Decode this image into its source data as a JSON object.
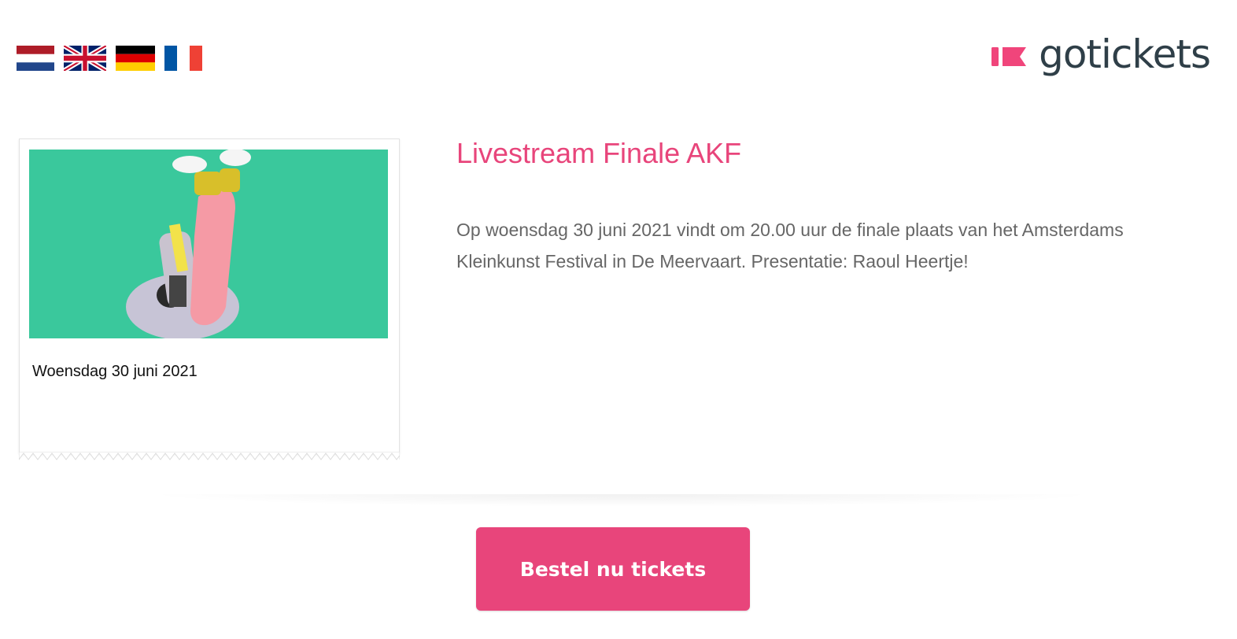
{
  "languages": [
    {
      "code": "nl",
      "name": "Nederlands"
    },
    {
      "code": "en",
      "name": "English"
    },
    {
      "code": "de",
      "name": "Deutsch"
    },
    {
      "code": "fr",
      "name": "Français"
    }
  ],
  "brand": {
    "logo_prefix": "go",
    "logo_suffix": "tickets",
    "accent_color": "#e8457b",
    "text_color": "#2f3f48"
  },
  "event": {
    "title": "Livestream Finale AKF",
    "description": "Op woensdag 30 juni 2021 vindt om 20.00 uur de finale plaats van het Amsterdams Kleinkunst Festival in De Meervaart. Presentatie: Raoul Heertje!",
    "date": "Woensdag 30 juni 2021",
    "image_icon": "event-photo"
  },
  "cta": {
    "label": "Bestel nu tickets"
  }
}
